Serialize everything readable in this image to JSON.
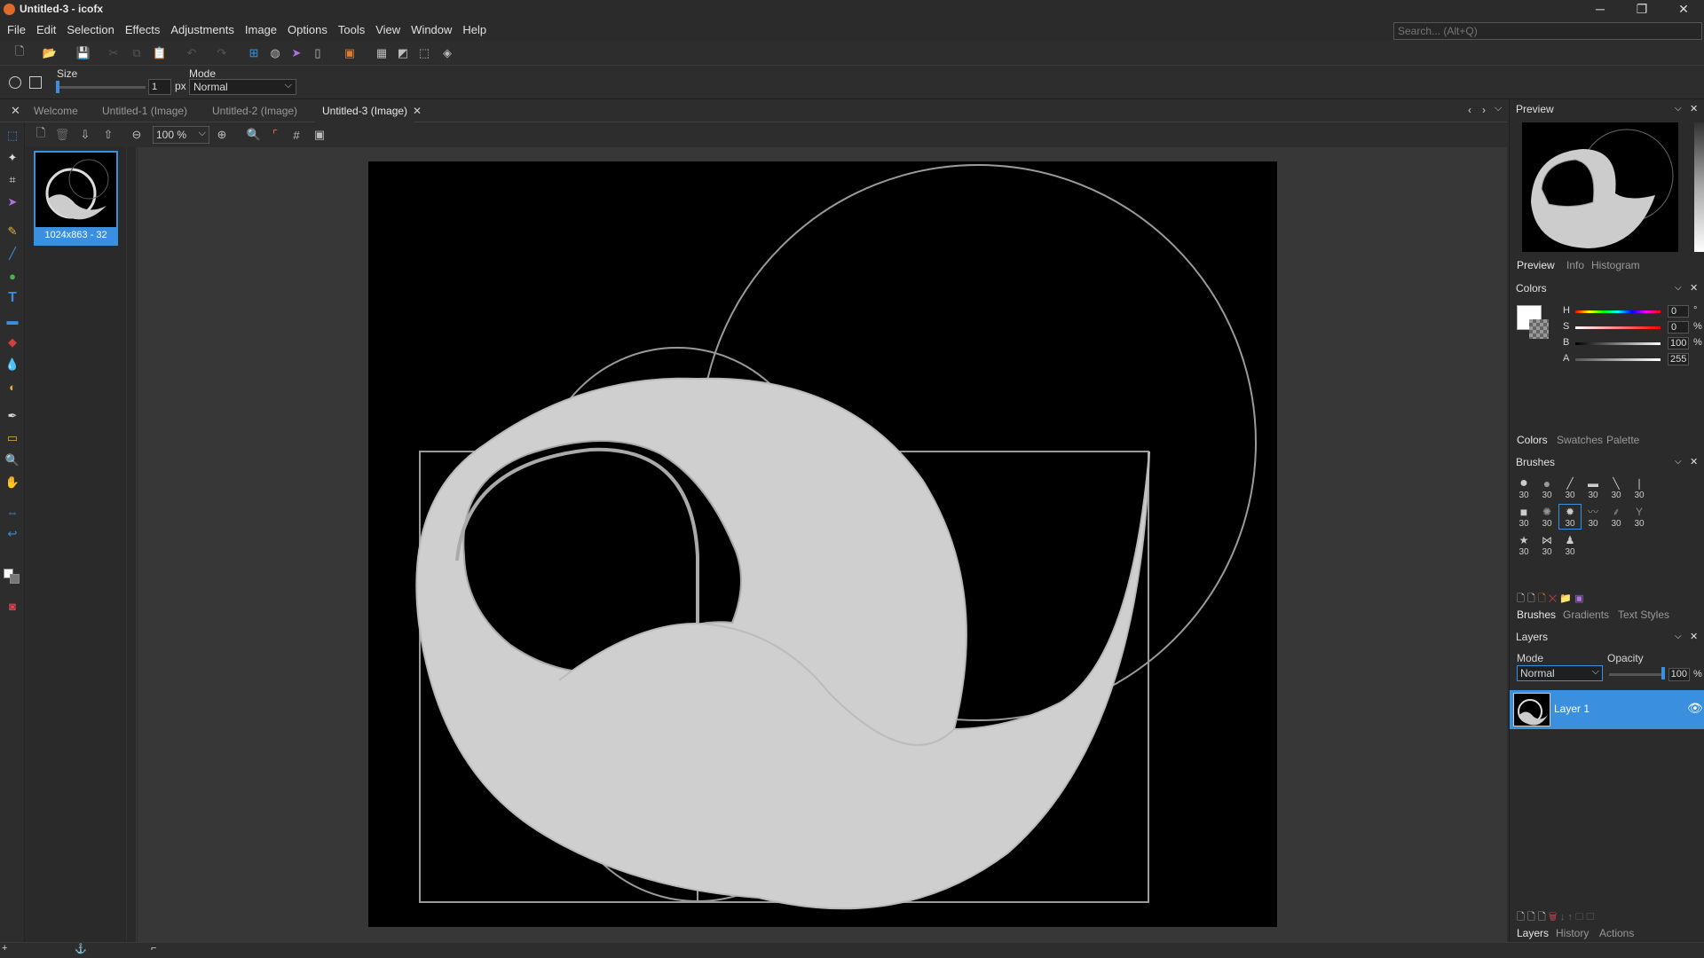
{
  "window": {
    "title": "Untitled-3 - icofx",
    "min": "─",
    "max": "❐",
    "close": "✕"
  },
  "menu": [
    "File",
    "Edit",
    "Selection",
    "Effects",
    "Adjustments",
    "Image",
    "Options",
    "Tools",
    "View",
    "Window",
    "Help"
  ],
  "search": {
    "placeholder": "Search... (Alt+Q)"
  },
  "options": {
    "size_label": "Size",
    "size_value": "1",
    "size_unit": "px",
    "mode_label": "Mode",
    "mode_value": "Normal"
  },
  "tabs": [
    "Welcome",
    "Untitled-1 (Image)",
    "Untitled-2 (Image)",
    "Untitled-3 (Image)"
  ],
  "canvas": {
    "zoom": "100 %",
    "thumb_label": "1024x863 - 32"
  },
  "preview": {
    "title": "Preview",
    "tabs": [
      "Preview",
      "Info",
      "Histogram"
    ]
  },
  "colors": {
    "title": "Colors",
    "h_label": "H",
    "s_label": "S",
    "b_label": "B",
    "a_label": "A",
    "h": "0",
    "s": "0",
    "b": "100",
    "a": "255",
    "h_unit": "°",
    "s_unit": "%",
    "b_unit": "%",
    "tabs": [
      "Colors",
      "Swatches",
      "Palette"
    ]
  },
  "brushes": {
    "title": "Brushes",
    "sizes": [
      "30",
      "30",
      "30",
      "30",
      "30",
      "30",
      "30",
      "30",
      "30",
      "30",
      "30",
      "30",
      "30"
    ],
    "tabs": [
      "Brushes",
      "Gradients",
      "Text Styles"
    ]
  },
  "layers": {
    "title": "Layers",
    "mode_label": "Mode",
    "mode_value": "Normal",
    "opacity_label": "Opacity",
    "opacity_value": "100",
    "opacity_unit": "%",
    "layer_name": "Layer 1",
    "tabs": [
      "Layers",
      "History",
      "Actions"
    ]
  },
  "accent": "#3a8fde"
}
